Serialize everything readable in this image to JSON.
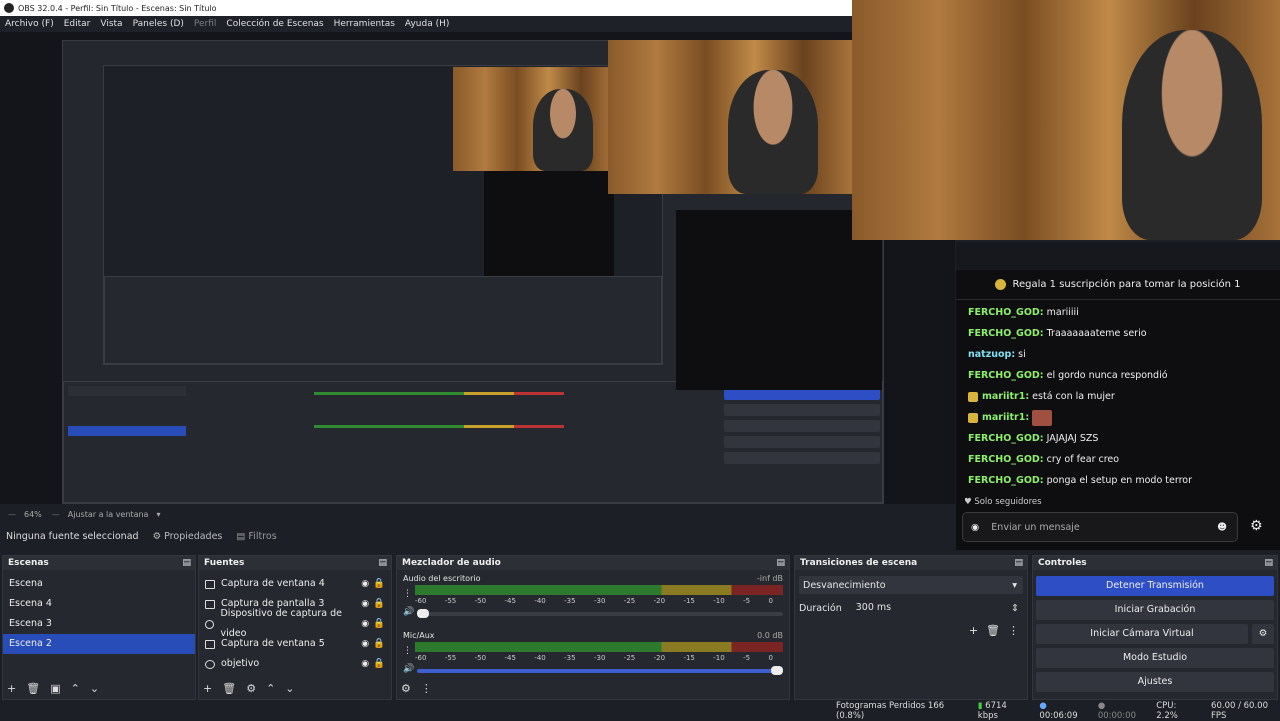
{
  "window": {
    "title": "OBS 32.0.4 - Perfil: Sin Título - Escenas: Sin Título"
  },
  "menu": {
    "items": [
      "Archivo (F)",
      "Editar",
      "Vista",
      "Paneles (D)",
      "Perfil",
      "Colección de Escenas",
      "Herramientas",
      "Ayuda (H)"
    ]
  },
  "chat": {
    "banner": "Regala 1 suscripción para tomar la posición 1",
    "messages": [
      {
        "user": "FERCHO_GOD:",
        "text": " mariiiii"
      },
      {
        "user": "FERCHO_GOD:",
        "text": " Traaaaaaateme serio"
      },
      {
        "user": "natzuop:",
        "text": " si"
      },
      {
        "user": "FERCHO_GOD:",
        "text": " el gordo nunca respondió"
      },
      {
        "user": "mariitr1:",
        "text": " está con la mujer"
      },
      {
        "user": "mariitr1:",
        "text": ""
      },
      {
        "user": "FERCHO_GOD:",
        "text": " JAJAJAJ SZS"
      },
      {
        "user": "FERCHO_GOD:",
        "text": " cry of fear creo"
      },
      {
        "user": "FERCHO_GOD:",
        "text": " ponga el setup en modo terror"
      }
    ],
    "followers_only": "Solo seguidores",
    "input_placeholder": "Enviar un mensaje"
  },
  "preview": {
    "zoom": "64%",
    "fit_label": "Ajustar a la ventana",
    "no_source": "Ninguna fuente seleccionad",
    "properties": "Propiedades",
    "filters": "Filtros"
  },
  "scenes": {
    "title": "Escenas",
    "items": [
      "Escena",
      "Escena 4",
      "Escena 3",
      "Escena 2"
    ],
    "selected": "Escena 2"
  },
  "sources": {
    "title": "Fuentes",
    "items": [
      "Captura de ventana 4",
      "Captura de pantalla 3",
      "Dispositivo de captura de video",
      "Captura de ventana 5",
      "objetivo"
    ]
  },
  "mixer": {
    "title": "Mezclador de audio",
    "ticks": [
      "-60",
      "-55",
      "-50",
      "-45",
      "-40",
      "-35",
      "-30",
      "-25",
      "-20",
      "-15",
      "-10",
      "-5",
      "0"
    ],
    "tracks": [
      {
        "name": "Audio del escritorio",
        "level": "-inf dB"
      },
      {
        "name": "Mic/Aux",
        "level": "0.0 dB"
      }
    ]
  },
  "transitions": {
    "title": "Transiciones de escena",
    "selected": "Desvanecimiento",
    "duration_label": "Duración",
    "duration_value": "300 ms"
  },
  "controls": {
    "title": "Controles",
    "stop_stream": "Detener Transmisión",
    "start_record": "Iniciar Grabación",
    "virtual_cam": "Iniciar Cámara Virtual",
    "studio_mode": "Modo Estudio",
    "settings": "Ajustes"
  },
  "status": {
    "dropped": "Fotogramas Perdidos 166 (0.8%)",
    "bitrate": "6714 kbps",
    "stream_time": "00:06:09",
    "rec_time": "00:00:00",
    "cpu": "CPU: 2.2%",
    "fps": "60.00 / 60.00 FPS"
  }
}
